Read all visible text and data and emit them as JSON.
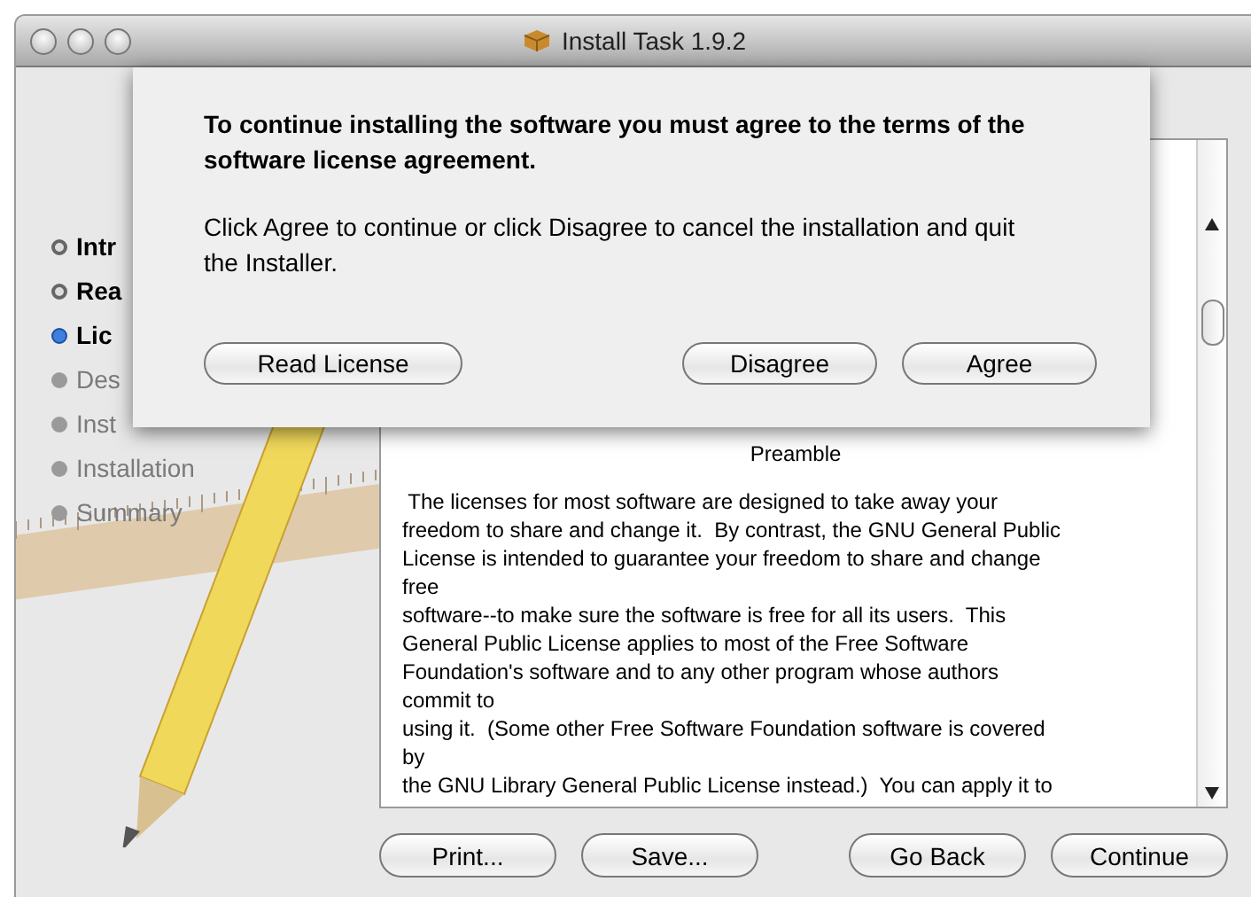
{
  "window": {
    "title": "Install Task 1.9.2"
  },
  "sidebar": {
    "items": [
      {
        "label": "Intr",
        "kind": "done"
      },
      {
        "label": "Rea",
        "kind": "done"
      },
      {
        "label": "Lic",
        "kind": "current"
      },
      {
        "label": "Des",
        "kind": "pending"
      },
      {
        "label": "Inst",
        "kind": "pending"
      },
      {
        "label": "Installation",
        "kind": "pending"
      },
      {
        "label": "Summary",
        "kind": "pending"
      }
    ]
  },
  "license_text": {
    "heading": "Preamble",
    "body": " The licenses for most software are designed to take away your\nfreedom to share and change it.  By contrast, the GNU General Public\nLicense is intended to guarantee your freedom to share and change\nfree\nsoftware--to make sure the software is free for all its users.  This\nGeneral Public License applies to most of the Free Software\nFoundation's software and to any other program whose authors\ncommit to\nusing it.  (Some other Free Software Foundation software is covered\nby\nthe GNU Library General Public License instead.)  You can apply it to"
  },
  "buttons": [
    {
      "label": "Print..."
    },
    {
      "label": "Save..."
    },
    {
      "label": "Go Back"
    },
    {
      "label": "Continue"
    }
  ],
  "sheet": {
    "title": "To continue installing the software you must agree to the terms of the software license agreement.",
    "message": "Click Agree to continue or click Disagree to cancel the installation and quit the Installer.",
    "buttons": [
      {
        "label": "Read License"
      },
      {
        "label": "Disagree"
      },
      {
        "label": "Agree"
      }
    ]
  }
}
